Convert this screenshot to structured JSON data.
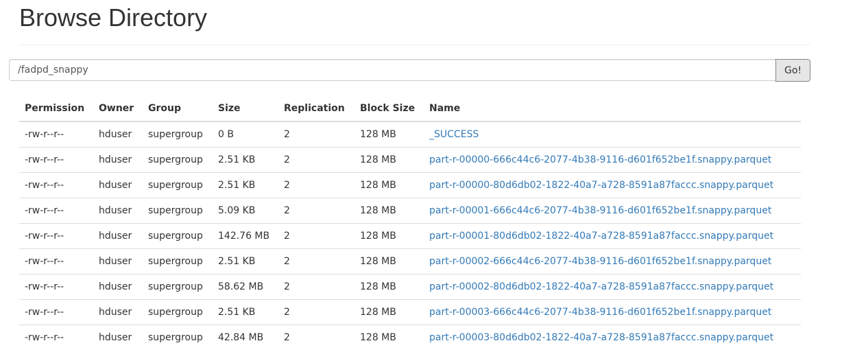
{
  "page": {
    "title": "Browse Directory"
  },
  "path_form": {
    "value": "/fadpd_snappy",
    "go_label": "Go!"
  },
  "table": {
    "headers": {
      "permission": "Permission",
      "owner": "Owner",
      "group": "Group",
      "size": "Size",
      "replication": "Replication",
      "block_size": "Block Size",
      "name": "Name"
    },
    "rows": [
      {
        "permission": "-rw-r--r--",
        "owner": "hduser",
        "group": "supergroup",
        "size": "0 B",
        "replication": "2",
        "block_size": "128 MB",
        "name": "_SUCCESS"
      },
      {
        "permission": "-rw-r--r--",
        "owner": "hduser",
        "group": "supergroup",
        "size": "2.51 KB",
        "replication": "2",
        "block_size": "128 MB",
        "name": "part-r-00000-666c44c6-2077-4b38-9116-d601f652be1f.snappy.parquet"
      },
      {
        "permission": "-rw-r--r--",
        "owner": "hduser",
        "group": "supergroup",
        "size": "2.51 KB",
        "replication": "2",
        "block_size": "128 MB",
        "name": "part-r-00000-80d6db02-1822-40a7-a728-8591a87faccc.snappy.parquet"
      },
      {
        "permission": "-rw-r--r--",
        "owner": "hduser",
        "group": "supergroup",
        "size": "5.09 KB",
        "replication": "2",
        "block_size": "128 MB",
        "name": "part-r-00001-666c44c6-2077-4b38-9116-d601f652be1f.snappy.parquet"
      },
      {
        "permission": "-rw-r--r--",
        "owner": "hduser",
        "group": "supergroup",
        "size": "142.76 MB",
        "replication": "2",
        "block_size": "128 MB",
        "name": "part-r-00001-80d6db02-1822-40a7-a728-8591a87faccc.snappy.parquet"
      },
      {
        "permission": "-rw-r--r--",
        "owner": "hduser",
        "group": "supergroup",
        "size": "2.51 KB",
        "replication": "2",
        "block_size": "128 MB",
        "name": "part-r-00002-666c44c6-2077-4b38-9116-d601f652be1f.snappy.parquet"
      },
      {
        "permission": "-rw-r--r--",
        "owner": "hduser",
        "group": "supergroup",
        "size": "58.62 MB",
        "replication": "2",
        "block_size": "128 MB",
        "name": "part-r-00002-80d6db02-1822-40a7-a728-8591a87faccc.snappy.parquet"
      },
      {
        "permission": "-rw-r--r--",
        "owner": "hduser",
        "group": "supergroup",
        "size": "2.51 KB",
        "replication": "2",
        "block_size": "128 MB",
        "name": "part-r-00003-666c44c6-2077-4b38-9116-d601f652be1f.snappy.parquet"
      },
      {
        "permission": "-rw-r--r--",
        "owner": "hduser",
        "group": "supergroup",
        "size": "42.84 MB",
        "replication": "2",
        "block_size": "128 MB",
        "name": "part-r-00003-80d6db02-1822-40a7-a728-8591a87faccc.snappy.parquet"
      }
    ]
  },
  "colors": {
    "link": "#337ab7",
    "text": "#333333",
    "border": "#dddddd",
    "button_bg": "#e6e6e6"
  }
}
